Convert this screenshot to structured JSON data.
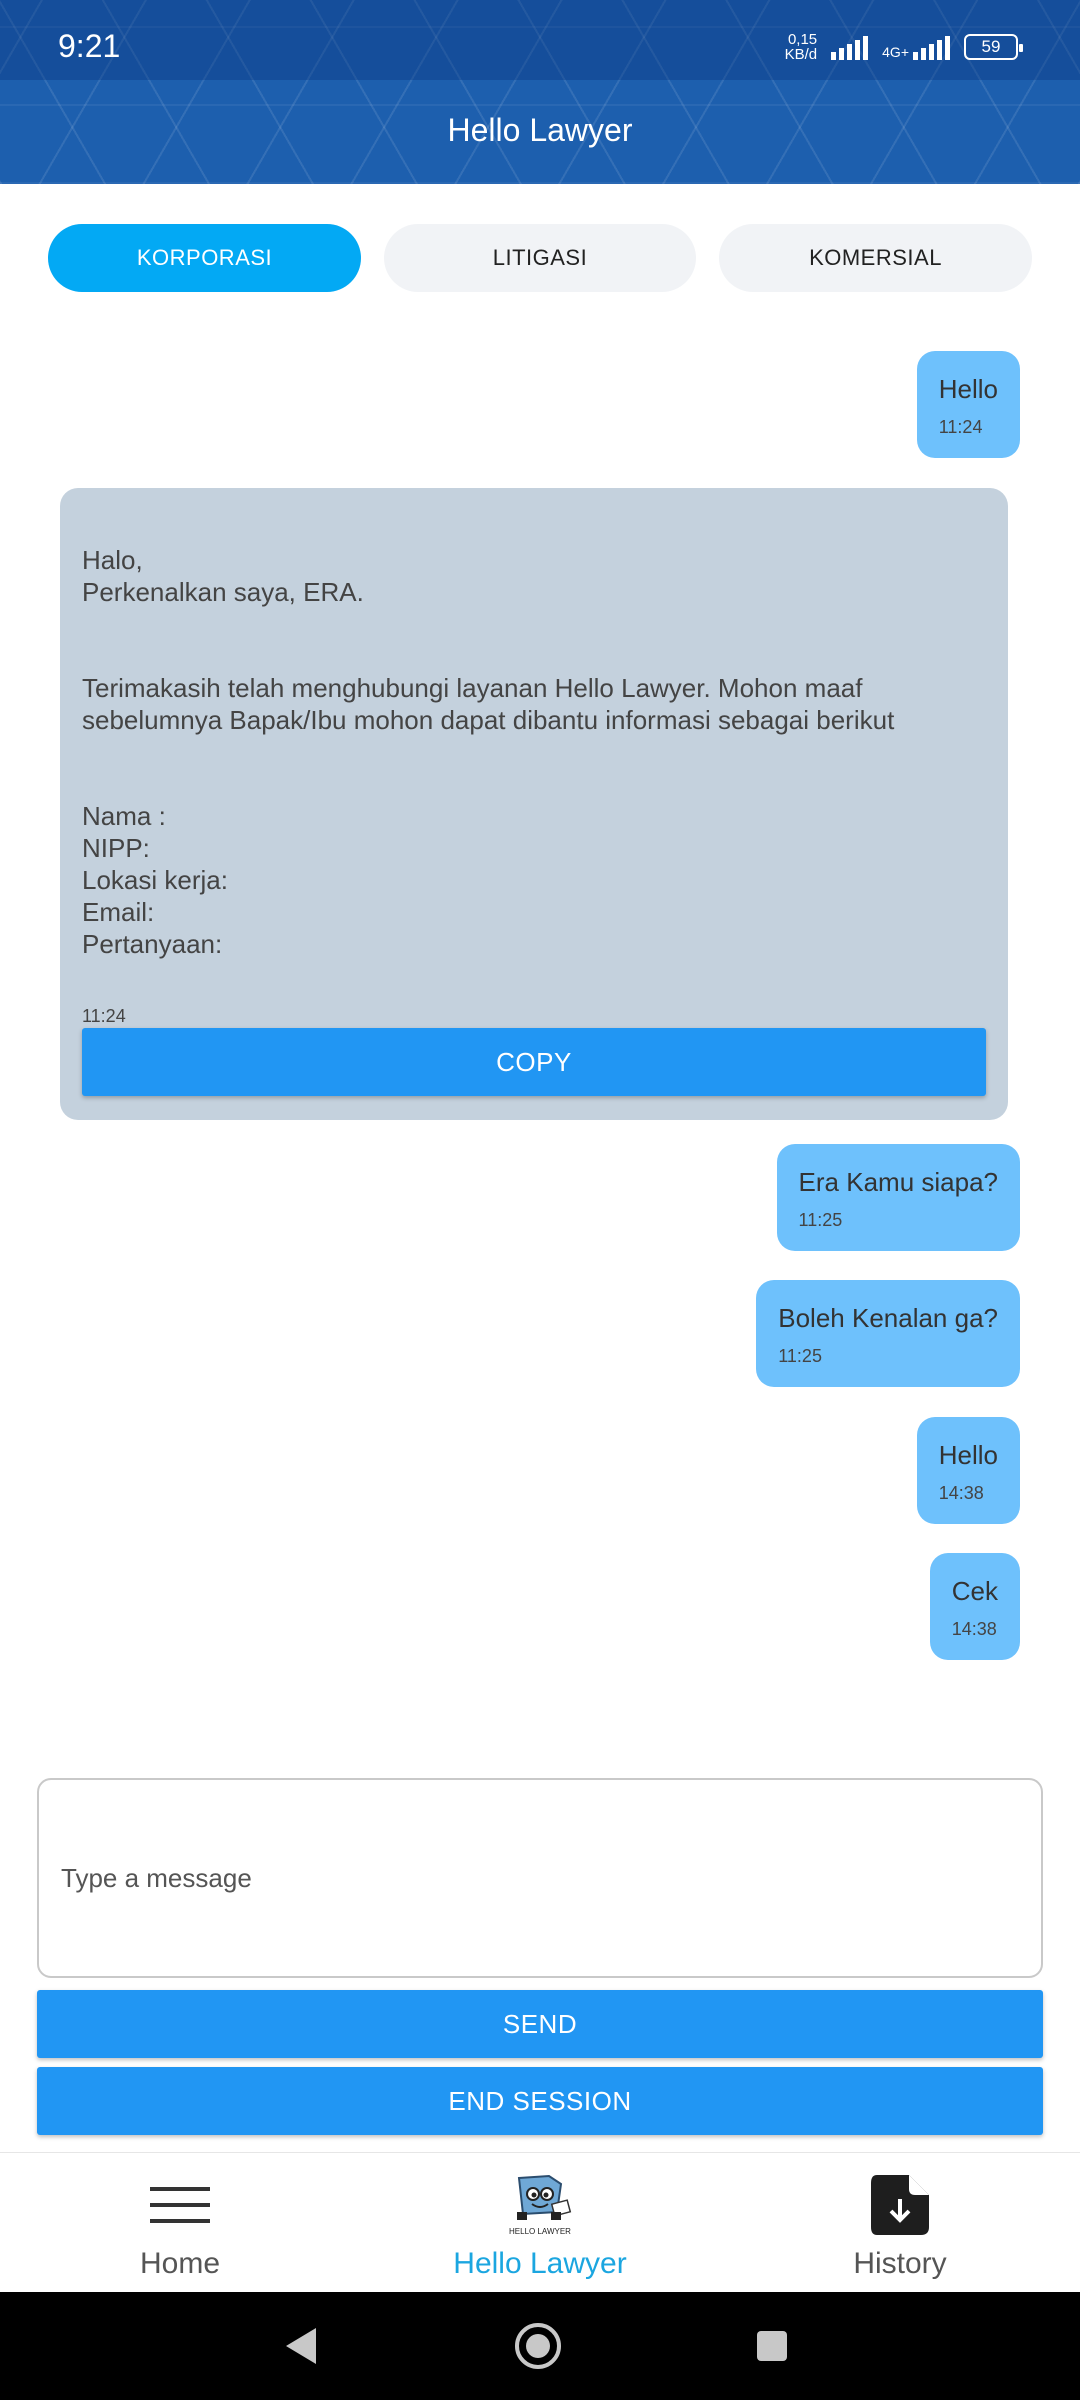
{
  "status_bar": {
    "time": "9:21",
    "net_speed_value": "0,15",
    "net_speed_unit": "KB/d",
    "network_type": "4G+",
    "battery": "59"
  },
  "header": {
    "title": "Hello Lawyer"
  },
  "tabs": [
    {
      "label": "KORPORASI",
      "active": true
    },
    {
      "label": "LITIGASI",
      "active": false
    },
    {
      "label": "KOMERSIAL",
      "active": false
    }
  ],
  "messages": [
    {
      "text": "Hello",
      "time": "11:24",
      "side": "right"
    },
    {
      "text": "Halo,\nPerkenalkan saya, ERA.\n\n\nTerimakasih telah menghubungi layanan Hello Lawyer. Mohon maaf sebelumnya Bapak/Ibu mohon dapat dibantu informasi sebagai berikut\n\n\nNama :\nNIPP:\nLokasi kerja:\nEmail:\nPertanyaan:",
      "time": "11:24",
      "side": "left",
      "copy_label": "COPY"
    },
    {
      "text": "Era Kamu siapa?",
      "time": "11:25",
      "side": "right"
    },
    {
      "text": "Boleh Kenalan ga?",
      "time": "11:25",
      "side": "right"
    },
    {
      "text": "Hello",
      "time": "14:38",
      "side": "right"
    },
    {
      "text": "Cek",
      "time": "14:38",
      "side": "right"
    }
  ],
  "composer": {
    "placeholder": "Type a message",
    "value": "",
    "send_label": "SEND",
    "end_session_label": "END SESSION"
  },
  "bottom_nav": [
    {
      "label": "Home",
      "icon": "menu-icon",
      "active": false
    },
    {
      "label": "Hello Lawyer",
      "icon": "hello-lawyer-logo",
      "active": true,
      "logo_text": "HELLO LAWYER"
    },
    {
      "label": "History",
      "icon": "download-file-icon",
      "active": false
    }
  ],
  "colors": {
    "header": "#1d5fae",
    "tab_active": "#03a9f4",
    "bubble_right": "#6ec1fc",
    "bubble_left": "#c4d1dd",
    "button": "#2196f3",
    "nav_active": "#1ba6e0"
  }
}
